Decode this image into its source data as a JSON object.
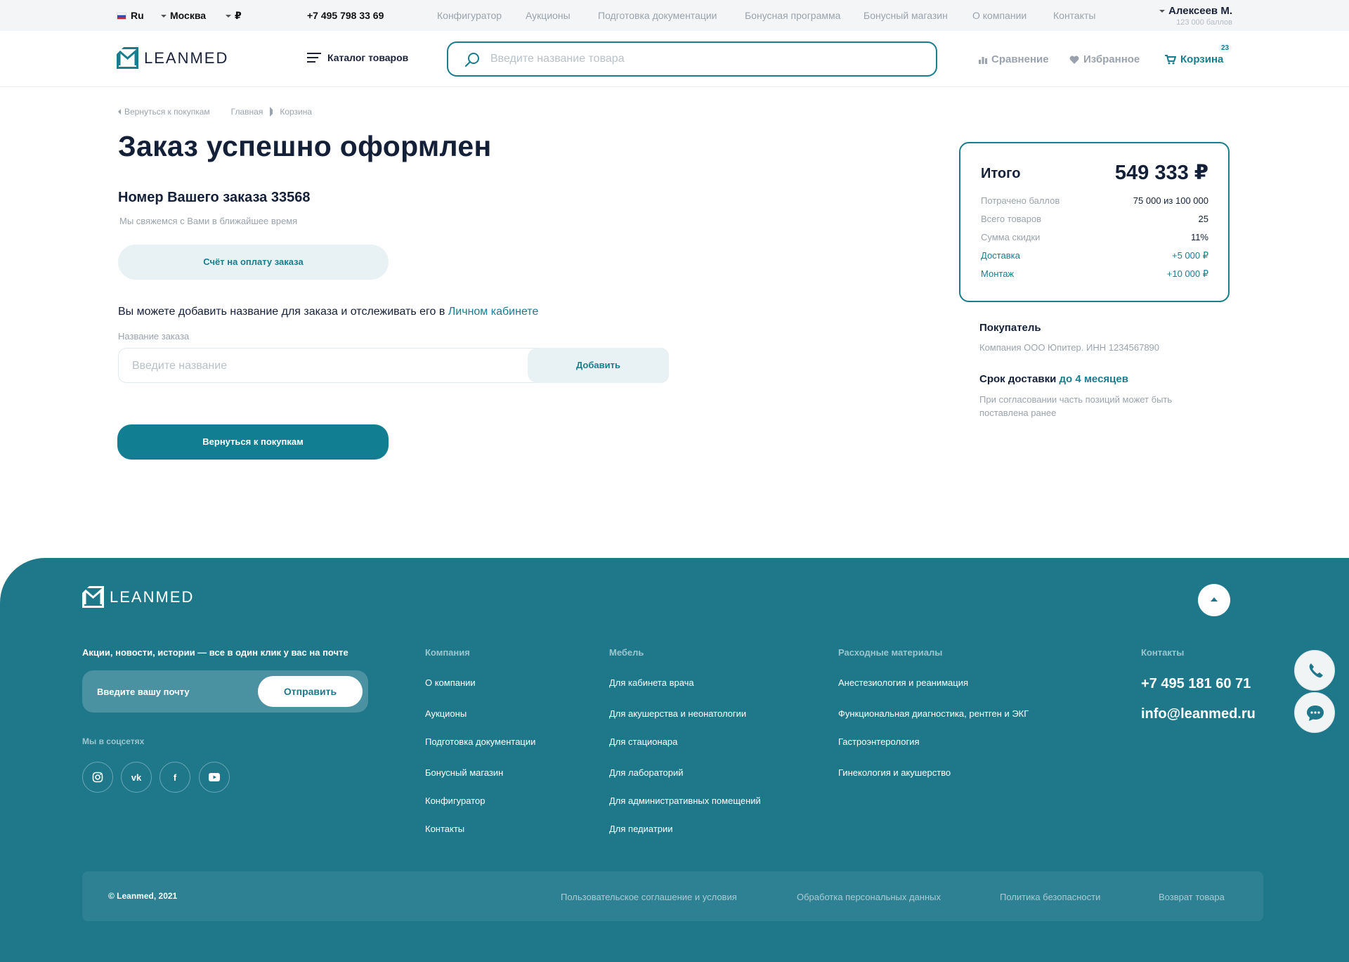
{
  "topbar": {
    "language": "Ru",
    "city": "Москва",
    "currency": "₽",
    "phone": "+7 495 798 33 69",
    "nav": [
      "Конфигуратор",
      "Аукционы",
      "Подготовка документации",
      "Бонусная программа",
      "Бонусный магазин",
      "О компании",
      "Контакты"
    ],
    "user_name": "Алексеев М.",
    "user_points": "123 000 баллов"
  },
  "header": {
    "logo_text": "LEANMED",
    "catalog_label": "Каталог товаров",
    "search_placeholder": "Введите название товара",
    "compare_label": "Сравнение",
    "favorites_label": "Избранное",
    "cart_label": "Корзина",
    "cart_count": "23"
  },
  "breadcrumbs": {
    "back": "Вернуться к покупкам",
    "items": [
      "Главная",
      "Корзина"
    ]
  },
  "main": {
    "title": "Заказ успешно оформлен",
    "order_number": "Номер Вашего заказа 33568",
    "contact_note": "Мы свяжемся с Вами в ближайшее время",
    "invoice_button": "Счёт на оплату заказа",
    "add_name_text": "Вы можете добавить название для заказа и отслеживать его в ",
    "add_name_link": "Личном кабинете",
    "name_label": "Название заказа",
    "name_placeholder": "Введите название",
    "add_button": "Добавить",
    "back_button": "Вернуться к покупкам"
  },
  "summary": {
    "total_label": "Итого",
    "total_value": "549 333 ₽",
    "rows": [
      {
        "label": "Потрачено баллов",
        "value": "75 000 из 100 000"
      },
      {
        "label": "Всего товаров",
        "value": "25"
      },
      {
        "label": "Сумма скидки",
        "value": "11%"
      },
      {
        "label": "Доставка",
        "value": "+5 000 ₽"
      },
      {
        "label": "Монтаж",
        "value": "+10 000 ₽"
      }
    ],
    "buyer_title": "Покупатель",
    "buyer_value": "Компания ООО Юпитер. ИНН 1234567890",
    "delivery_title": "Срок доставки ",
    "delivery_highlight": "до 4 месяцев",
    "delivery_note": "При согласовании часть позиций может быть поставлена ранее"
  },
  "footer": {
    "logo_text": "LEANMED",
    "promo": "Акции, новости, истории — все в один клик у вас на почте",
    "email_placeholder": "Введите вашу почту",
    "send_button": "Отправить",
    "social_title": "Мы в соцсетях",
    "social_icons": [
      "instagram-icon",
      "vk-icon",
      "facebook-icon",
      "youtube-icon"
    ],
    "col_company_title": "Компания",
    "col_company": [
      "О компании",
      "Аукционы",
      "Подготовка документации",
      "Бонусный магазин",
      "Конфигуратор",
      "Контакты"
    ],
    "col_furniture_title": "Мебель",
    "col_furniture": [
      "Для кабинета врача",
      "Для акушерства и неонатологии",
      "Для стационара",
      "Для лабораторий",
      "Для административных помещений",
      "Для педиатрии"
    ],
    "col_supplies_title": "Расходные материалы",
    "col_supplies": [
      "Анестезиология и реанимация",
      "Функциональная диагностика, рентген и ЭКГ",
      "Гастроэнтерология",
      "Гинекология и акушерство"
    ],
    "contacts_title": "Контакты",
    "phone": "+7 495 181 60 71",
    "email": "info@leanmed.ru",
    "copyright": "© Leanmed, 2021",
    "bottom_links": [
      "Пользовательское соглашение и условия",
      "Обработка персональных данных",
      "Политика безопасности",
      "Возврат товара"
    ]
  },
  "colors": {
    "accent": "#197d8e",
    "footer": "#1f788a",
    "title": "#142038"
  }
}
